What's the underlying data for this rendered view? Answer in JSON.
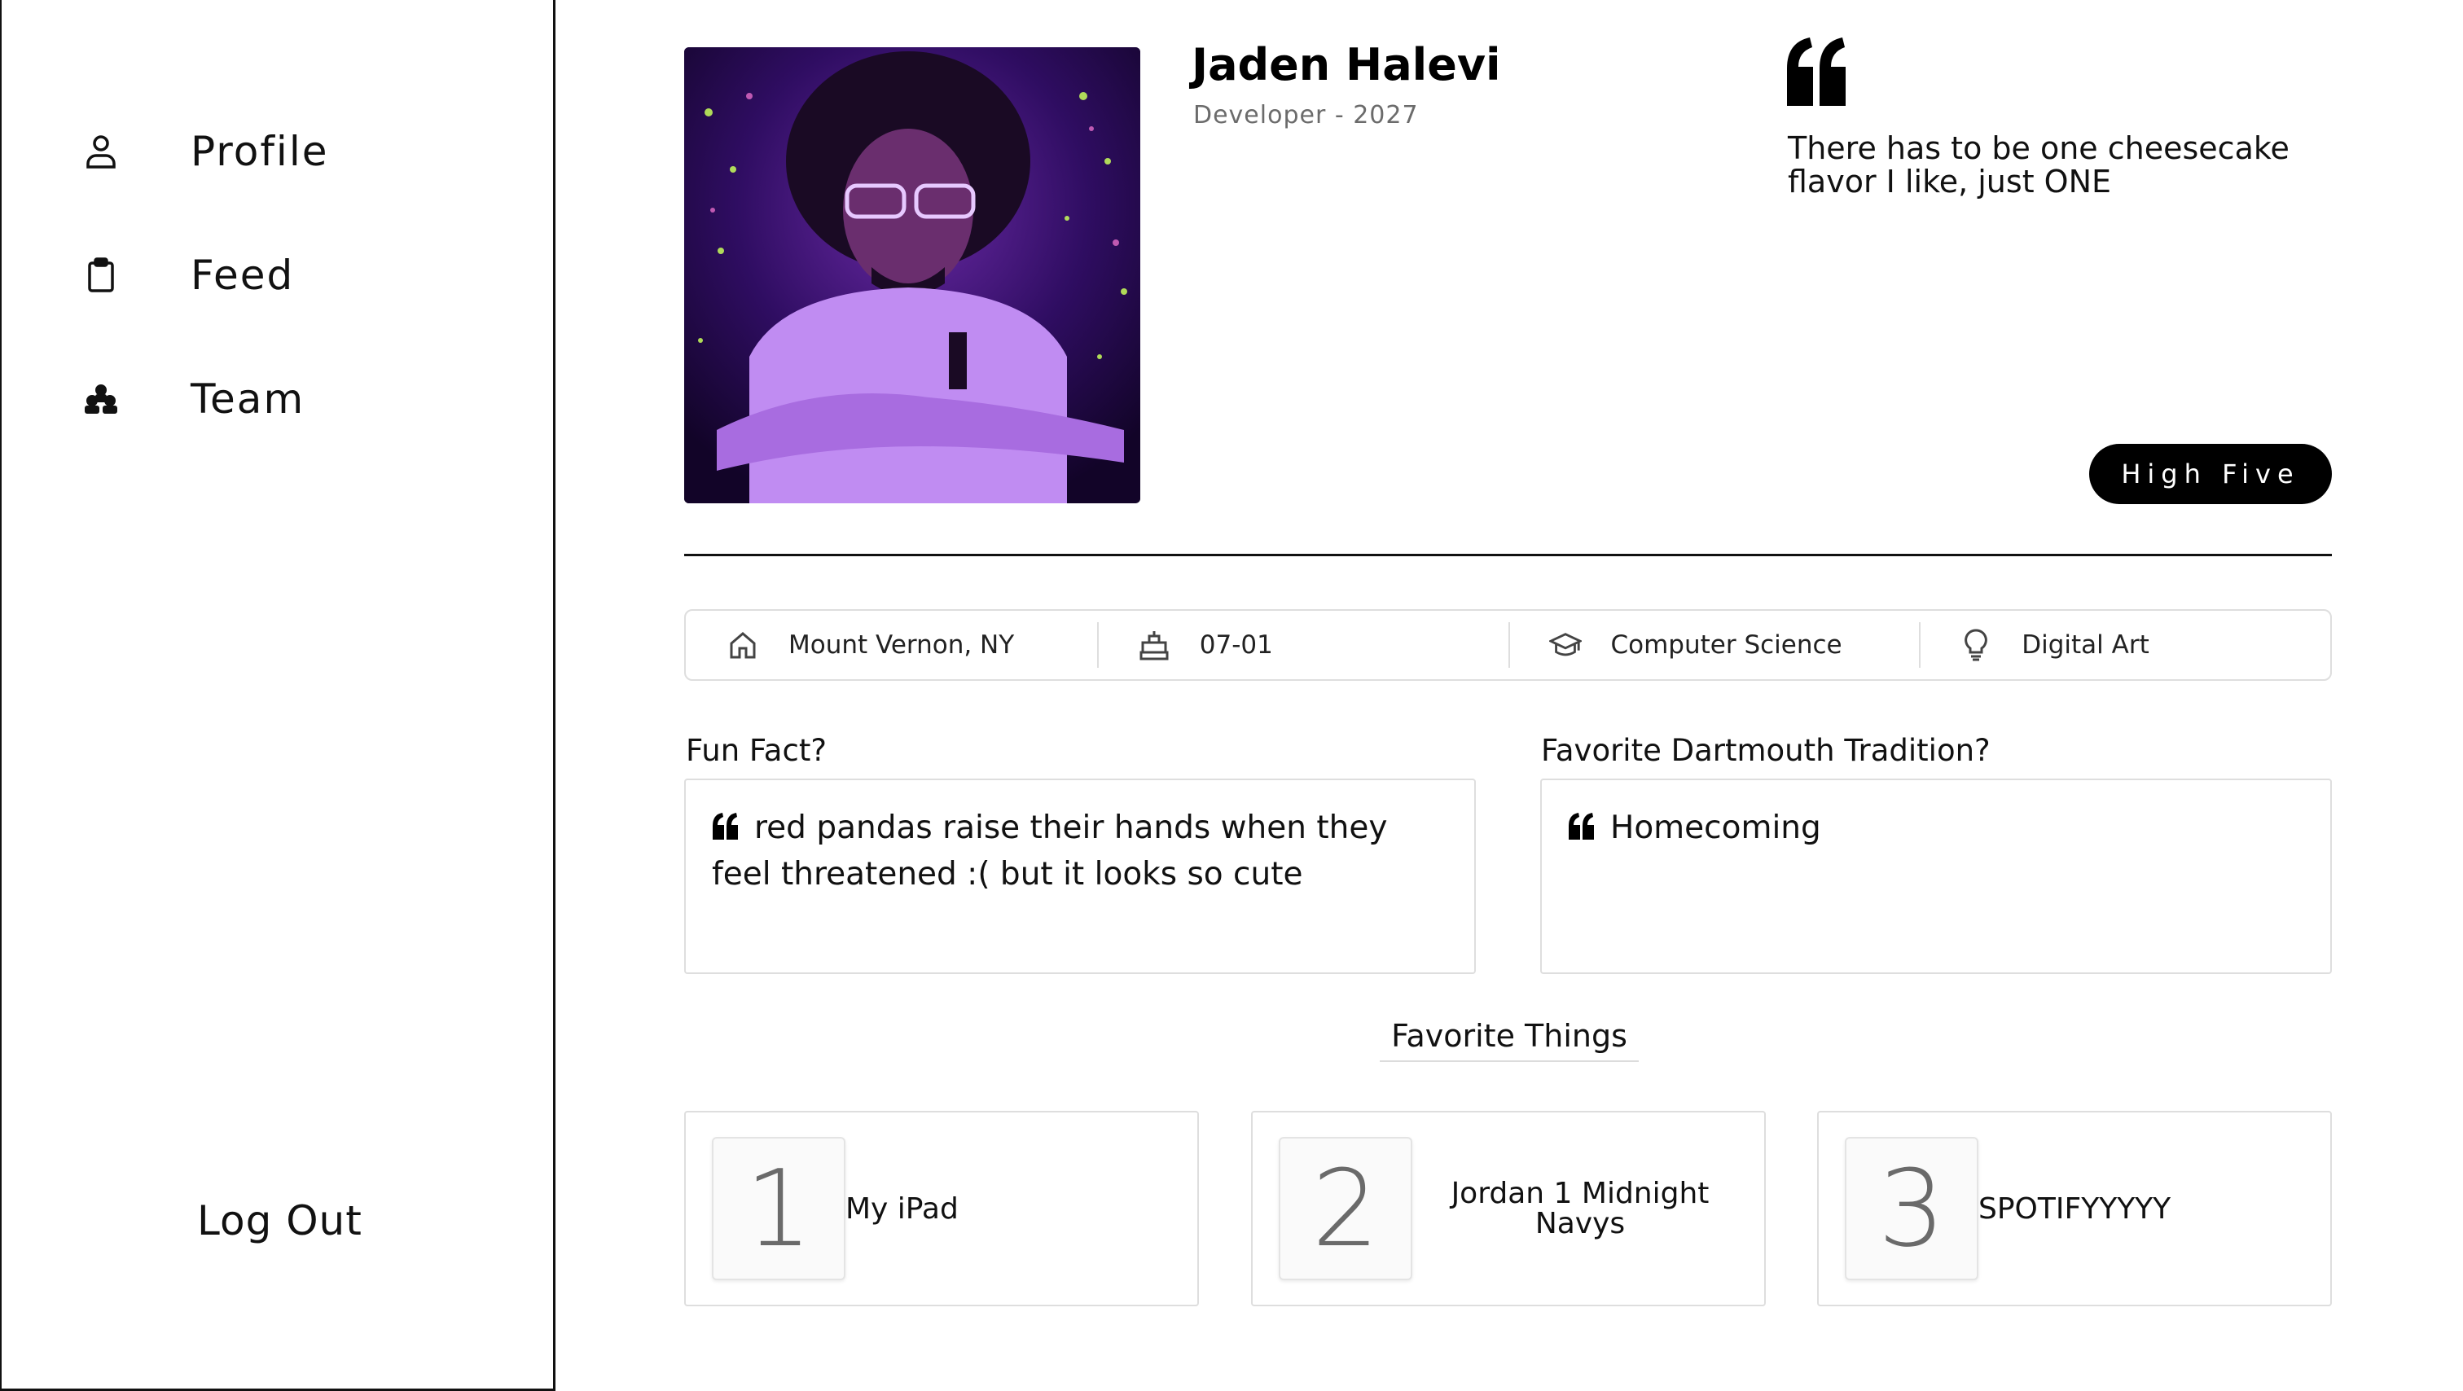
{
  "sidebar": {
    "items": [
      {
        "label": "Profile",
        "icon": "person-icon"
      },
      {
        "label": "Feed",
        "icon": "clipboard-icon"
      },
      {
        "label": "Team",
        "icon": "people-group-icon"
      }
    ],
    "logout_label": "Log Out"
  },
  "profile": {
    "name": "Jaden Halevi",
    "role": "Developer - 2027",
    "quote": "There has to be one cheesecake flavor I like, just ONE",
    "high_five_label": "High Five"
  },
  "info": [
    {
      "icon": "home-icon",
      "text": "Mount Vernon, NY"
    },
    {
      "icon": "cake-icon",
      "text": "07-01"
    },
    {
      "icon": "graduation-cap-icon",
      "text": "Computer Science"
    },
    {
      "icon": "lightbulb-icon",
      "text": "Digital Art"
    }
  ],
  "questions": [
    {
      "title": "Fun Fact?",
      "answer": "red pandas raise their hands when they feel threatened :( but it looks so cute"
    },
    {
      "title": "Favorite Dartmouth Tradition?",
      "answer": "Homecoming"
    }
  ],
  "favorites": {
    "heading": "Favorite Things",
    "items": [
      {
        "rank": "1",
        "text": "My iPad"
      },
      {
        "rank": "2",
        "text": "Jordan 1 Midnight Navys"
      },
      {
        "rank": "3",
        "text": "SPOTIFYYYYY"
      }
    ]
  },
  "colors": {
    "accent": "#000000",
    "border": "#dedede",
    "muted_text": "#6b6b6b",
    "photo_tint": "#5a1f8c"
  }
}
